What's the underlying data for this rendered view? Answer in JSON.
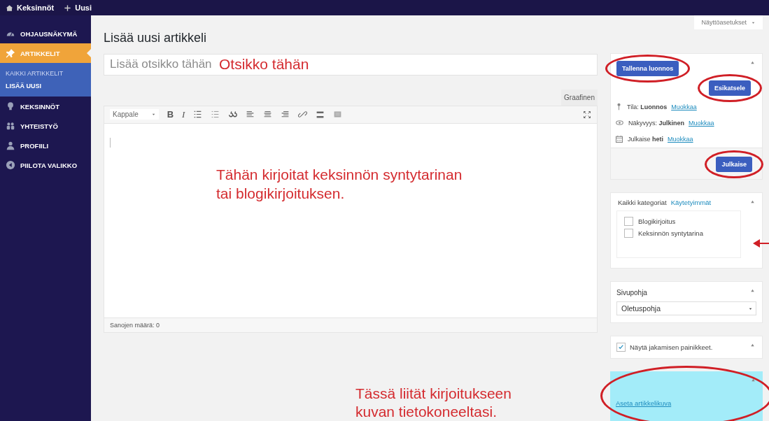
{
  "topbar": {
    "items": [
      {
        "label": "Keksinnöt"
      },
      {
        "label": "Uusi"
      }
    ]
  },
  "sidebar": {
    "items": [
      {
        "label": "OHJAUSNÄKYMÄ",
        "selected": false
      },
      {
        "label": "ARTIKKELIT",
        "selected": true,
        "children": [
          {
            "label": "KAIKKI ARTIKKELIT",
            "selected": false
          },
          {
            "label": "LISÄÄ UUSI",
            "selected": true
          }
        ]
      },
      {
        "label": "KEKSINNÖT",
        "selected": false
      },
      {
        "label": "YHTEISTYÖ",
        "selected": false
      },
      {
        "label": "PROFIILI",
        "selected": false
      },
      {
        "label": "PIILOTA VALIKKO",
        "selected": false
      }
    ]
  },
  "page": {
    "title": "Lisää uusi artikkeli",
    "screen_options": "Näyttöasetukset"
  },
  "title_field": {
    "placeholder": "Lisää otsikko tähän"
  },
  "editor": {
    "mode_tab": "Graafinen",
    "format": "Kappale",
    "bold": "B",
    "italic": "I",
    "word_count": "Sanojen määrä: 0"
  },
  "publish": {
    "save_draft": "Tallenna luonnos",
    "preview": "Esikatsele",
    "rows": [
      {
        "text": "Tila: **Luonnos**",
        "link": "Muokkaa"
      },
      {
        "text": "Näkyvyys: **Julkinen**",
        "link": "Muokkaa"
      },
      {
        "text": "Julkaise **heti**",
        "link": "Muokkaa"
      }
    ],
    "publish_button": "Julkaise"
  },
  "categories": {
    "tabs": [
      {
        "label": "Kaikki kategoriat",
        "selected": true
      },
      {
        "label": "Käytetyimmät",
        "selected": false
      }
    ],
    "items": [
      {
        "label": "Blogikirjoitus",
        "checked": false
      },
      {
        "label": "Keksinnön syntytarina",
        "checked": false
      }
    ]
  },
  "template": {
    "title": "Sivupohja",
    "value": "Oletuspohja"
  },
  "sharing": {
    "label": "Näytä jakamisen painikkeet.",
    "checked": true
  },
  "featured_image": {
    "link": "Aseta artikkelikuva"
  },
  "annotations": {
    "title_hint": "Otsikko tähän",
    "editor_hint": [
      "Tähän kirjoitat keksinnön syntytarinan",
      "tai blogikirjoituksen."
    ],
    "image_hint": [
      "Tässä liität kirjoitukseen",
      "kuvan tietokoneeltasi."
    ]
  }
}
